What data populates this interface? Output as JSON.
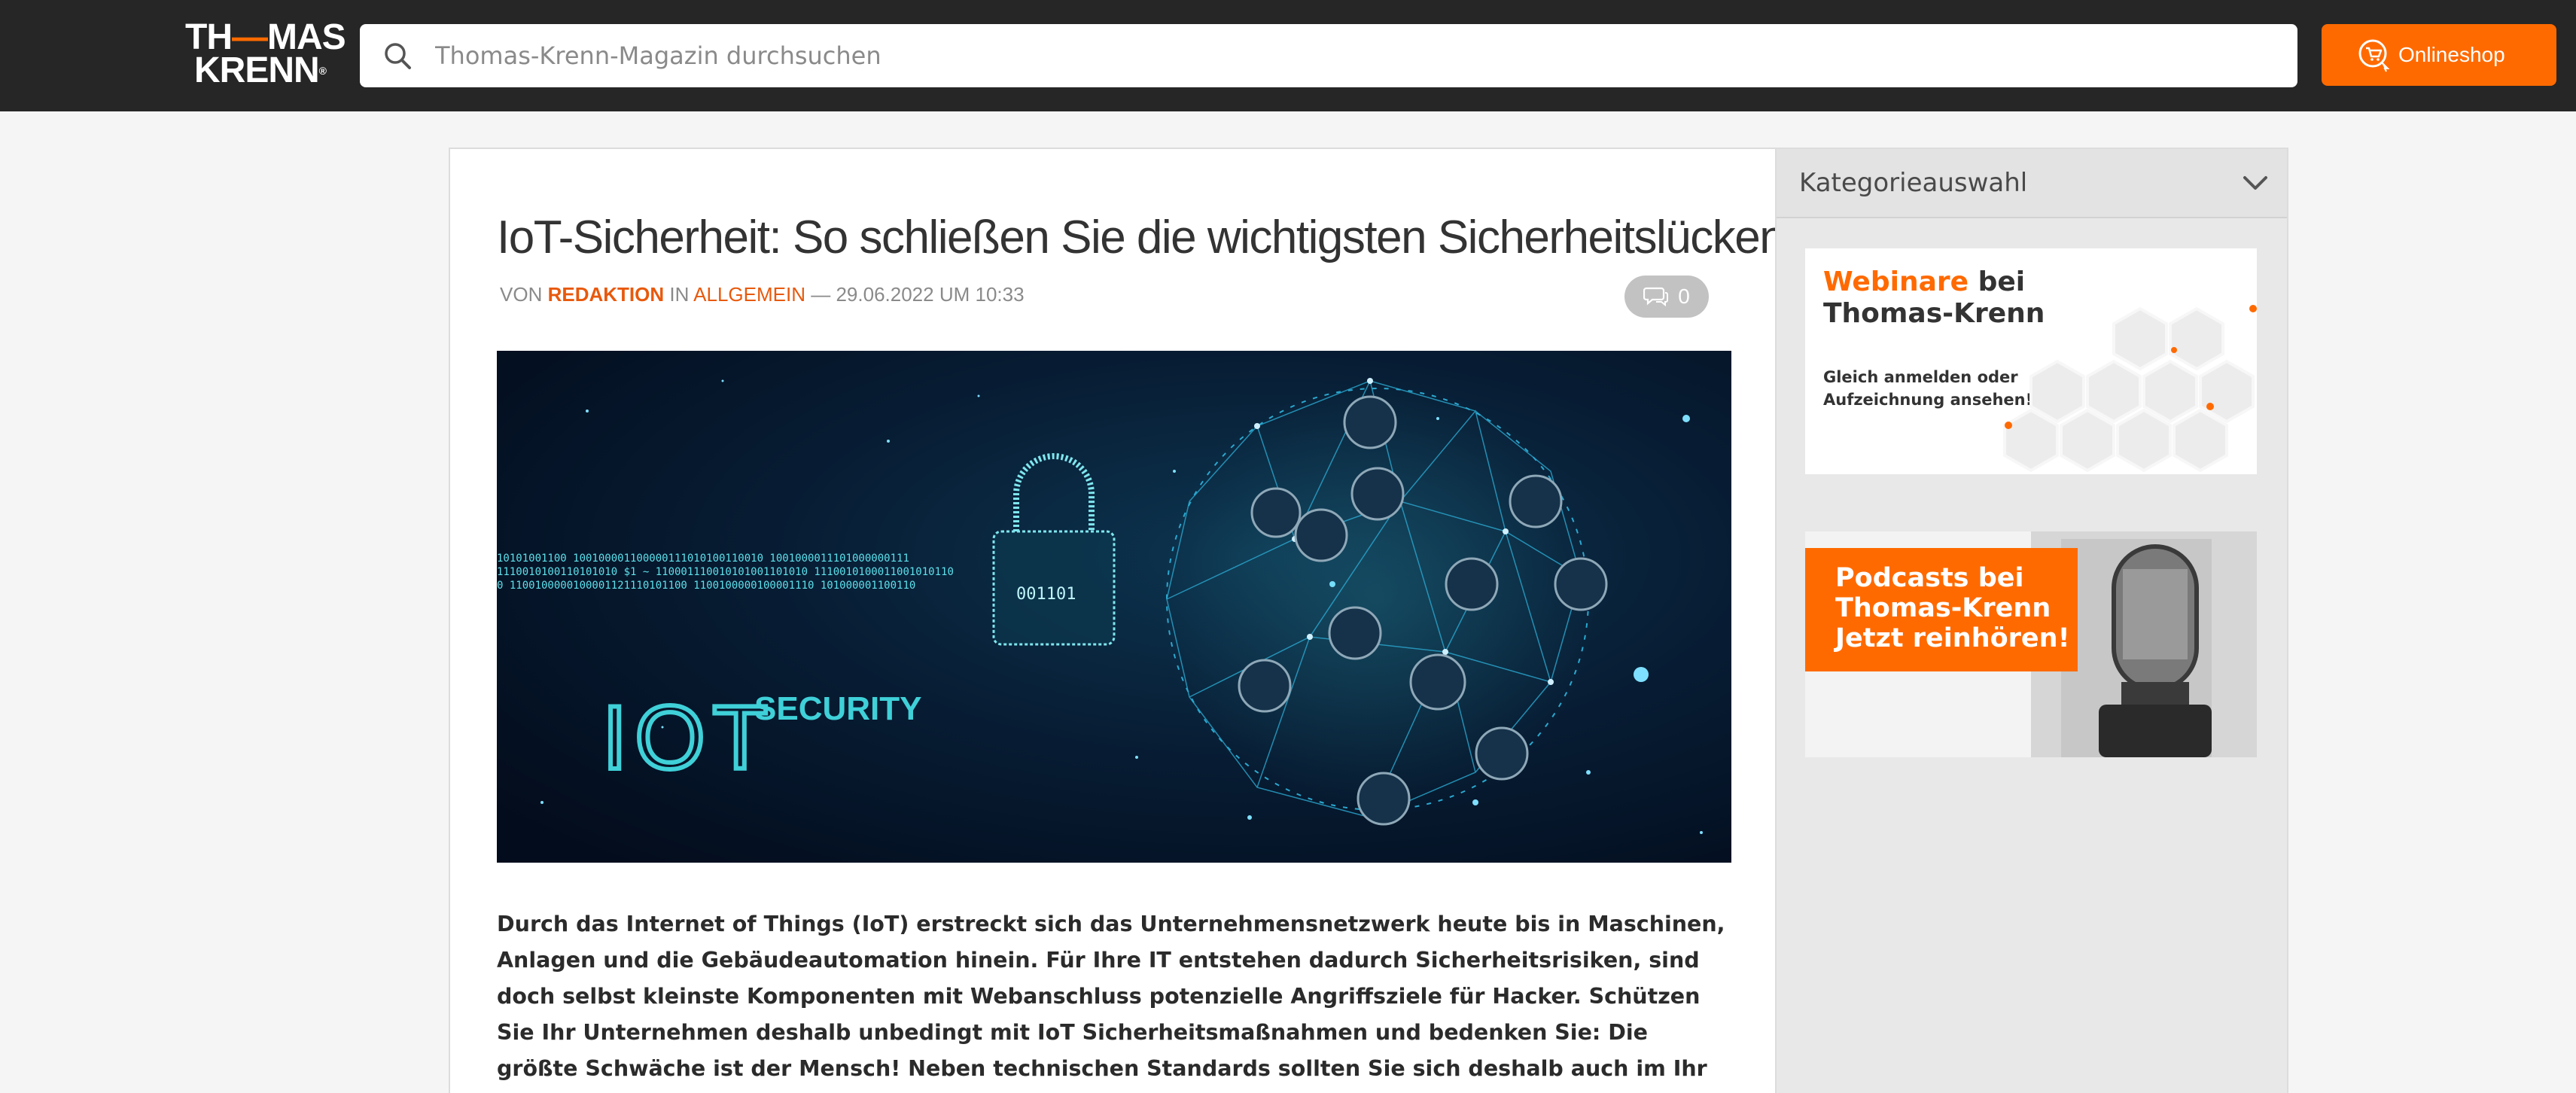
{
  "header": {
    "logo_line1_left": "TH",
    "logo_line1_dash": "—",
    "logo_line1_right": "MAS",
    "logo_line2": "KRENN",
    "logo_reg": "®",
    "search_placeholder": "Thomas-Krenn-Magazin durchsuchen",
    "shop_label": "Onlineshop"
  },
  "article": {
    "title": "IoT-Sicherheit: So schließen Sie die wichtigsten Sicherheitslücken",
    "meta": {
      "by_label": "VON",
      "author": "REDAKTION",
      "in_label": "IN",
      "category": "ALLGEMEIN",
      "separator": "—",
      "date": "29.06.2022 UM 10:33"
    },
    "comment_count": "0",
    "hero": {
      "text_iot": "IOT",
      "text_security": "SECURITY",
      "binary_line1": "10101001100   100100001100000111010100110010   1001000011101000000111",
      "binary_line2": "1110010100110101010   $1 ~ 110001110010101001101010   1110010100011001010110",
      "binary_line3": "0     1100100000100001121110101100    1100100000100001110 101000001100110",
      "lock_bits": "001101"
    },
    "lead": "Durch das Internet of Things (IoT) erstreckt sich das Unternehmensnetzwerk heute bis in Maschinen, Anlagen und die Gebäudeautomation hinein. Für Ihre IT entstehen dadurch Sicherheitsrisiken, sind doch selbst kleinste Komponenten mit Webanschluss potenzielle Angriffsziele für Hacker. Schützen Sie Ihr Unternehmen deshalb unbedingt mit IoT Sicherheitsmaßnahmen und bedenken Sie: Die größte Schwäche ist der Mensch! Neben technischen Standards sollten Sie sich deshalb auch im Ihr Personal kümmern."
  },
  "sidebar": {
    "category_label": "Kategorieauswahl",
    "banner_webinar": {
      "title_orange": "Webinare",
      "title_rest1": " bei",
      "title_line2": "Thomas-Krenn",
      "sub_line1": "Gleich anmelden oder",
      "sub_line2": "Aufzeichnung ansehen!"
    },
    "banner_podcast": {
      "line1": "Podcasts bei",
      "line2": "Thomas-Krenn",
      "line3": "Jetzt reinhören!"
    }
  },
  "colors": {
    "brand_orange": "#ff6a00",
    "link_orange": "#e8590c",
    "header_bg": "#262626",
    "hero_bg": "#041224",
    "hero_cyan": "#3fd0d8"
  }
}
